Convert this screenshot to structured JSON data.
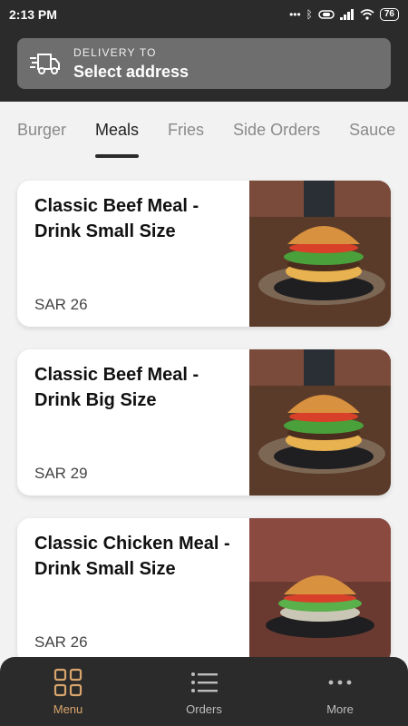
{
  "status_bar": {
    "time": "2:13 PM",
    "battery": "76"
  },
  "header": {
    "delivery_label": "DELIVERY TO",
    "address_value": "Select address"
  },
  "tabs": [
    {
      "label": "Burger"
    },
    {
      "label": "Meals"
    },
    {
      "label": "Fries"
    },
    {
      "label": "Side Orders"
    },
    {
      "label": "Sauce"
    }
  ],
  "active_tab": "Meals",
  "items": [
    {
      "name": "Classic Beef Meal - Drink Small Size",
      "price": "SAR 26"
    },
    {
      "name": "Classic Beef Meal - Drink Big Size",
      "price": "SAR 29"
    },
    {
      "name": "Classic Chicken Meal - Drink Small Size",
      "price": "SAR 26"
    }
  ],
  "bottom_nav": {
    "menu": "Menu",
    "orders": "Orders",
    "more": "More"
  },
  "colors": {
    "dark": "#2b2b2b",
    "accent": "#d8a56c",
    "address_box": "#6e6e6e"
  }
}
